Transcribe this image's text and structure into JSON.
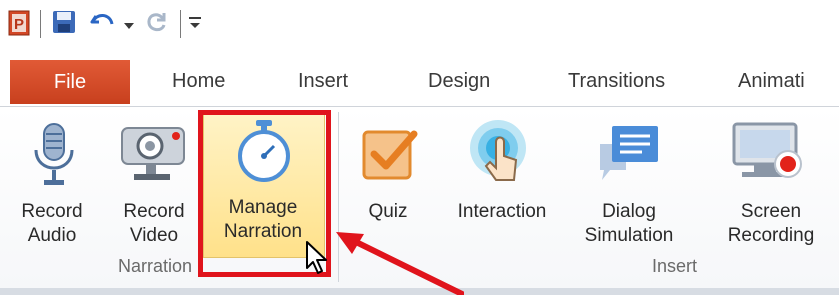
{
  "qat": {
    "app_icon": "powerpoint-icon",
    "save_icon": "save-icon",
    "undo_icon": "undo-icon",
    "undo_dropdown_icon": "chevron-down-icon",
    "redo_icon": "redo-icon",
    "customize_icon": "customize-qat-icon"
  },
  "tabs": {
    "file": "File",
    "home": "Home",
    "insert": "Insert",
    "design": "Design",
    "transitions": "Transitions",
    "animations": "Animati"
  },
  "ribbon": {
    "narration_group": {
      "label": "Narration",
      "record_audio": {
        "line1": "Record",
        "line2": "Audio",
        "icon": "microphone-icon"
      },
      "record_video": {
        "line1": "Record",
        "line2": "Video",
        "icon": "webcam-icon"
      },
      "manage_narration": {
        "line1": "Manage",
        "line2": "Narration",
        "icon": "stopwatch-icon"
      }
    },
    "insert_group": {
      "label": "Insert",
      "quiz": {
        "line1": "Quiz",
        "icon": "quiz-checkbox-icon"
      },
      "interaction": {
        "line1": "Interaction",
        "icon": "touch-icon"
      },
      "dialog_simulation": {
        "line1": "Dialog",
        "line2": "Simulation",
        "icon": "dialog-icon"
      },
      "screen_recording": {
        "line1": "Screen",
        "line2": "Recording",
        "icon": "screen-recording-icon"
      }
    }
  },
  "annotation": {
    "highlight_color": "#e0141c",
    "arrow_icon": "red-arrow-icon",
    "cursor_icon": "mouse-cursor-icon"
  }
}
